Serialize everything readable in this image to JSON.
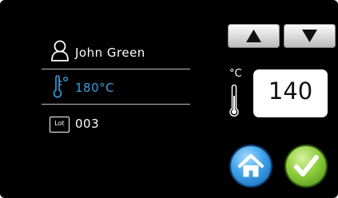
{
  "operator": {
    "icon": "user-icon",
    "name": "John Green"
  },
  "temperature": {
    "icon": "thermometer-degree-icon",
    "setpoint": "180°C",
    "accent_color": "#3aa0e0"
  },
  "lot": {
    "icon": "lot-icon",
    "badge": "Lot",
    "number": "003"
  },
  "controls": {
    "up_icon": "triangle-up-icon",
    "down_icon": "triangle-down-icon",
    "unit_label": "°C",
    "thermometer_icon": "thermometer-icon",
    "current_value": "140",
    "home_icon": "home-icon",
    "confirm_icon": "checkmark-icon"
  }
}
